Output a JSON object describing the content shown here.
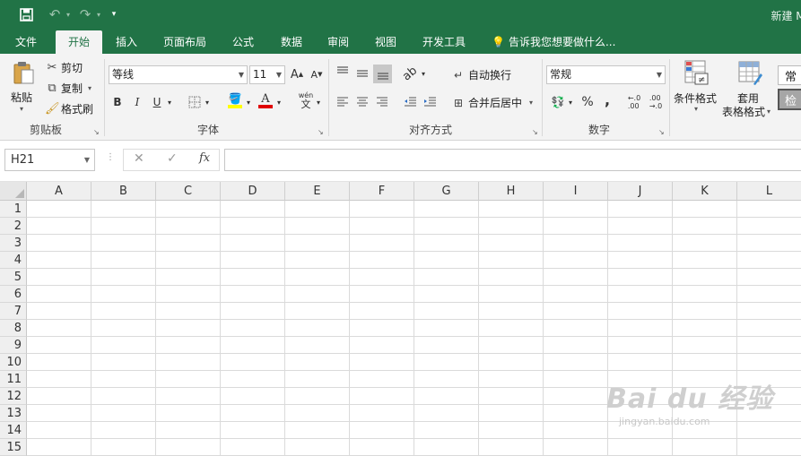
{
  "colors": {
    "brand": "#217346",
    "ribbon_bg": "#f3f3f3",
    "font_color_bar": "#e00000",
    "fill_color_bar": "#ffff00"
  },
  "titlebar": {
    "save_icon": "save-icon",
    "undo_icon": "undo-icon",
    "redo_icon": "redo-icon",
    "title": "新建 Mi"
  },
  "tabs": [
    {
      "label": "文件"
    },
    {
      "label": "开始"
    },
    {
      "label": "插入"
    },
    {
      "label": "页面布局"
    },
    {
      "label": "公式"
    },
    {
      "label": "数据"
    },
    {
      "label": "审阅"
    },
    {
      "label": "视图"
    },
    {
      "label": "开发工具"
    }
  ],
  "tell_me": "告诉我您想要做什么...",
  "clipboard": {
    "paste": "粘贴",
    "cut": "剪切",
    "copy": "复制",
    "format_painter": "格式刷",
    "group": "剪贴板"
  },
  "font": {
    "name": "等线",
    "size": "11",
    "bold": "B",
    "italic": "I",
    "underline": "U",
    "phonetic_top": "wén",
    "phonetic_bottom": "文",
    "grow": "A",
    "shrink": "A",
    "color_letter": "A",
    "group": "字体"
  },
  "alignment": {
    "wrap_text": "自动换行",
    "merge_center": "合并后居中",
    "group": "对齐方式"
  },
  "number": {
    "format": "常规",
    "percent": "%",
    "comma": ",",
    "group": "数字"
  },
  "styles": {
    "conditional": "条件格式",
    "table_top": "套用",
    "table_bottom": "表格格式",
    "style_normal": "常",
    "style_check": "检"
  },
  "formula_bar": {
    "name_box": "H21",
    "cancel": "✕",
    "enter": "✓",
    "fx": "fx"
  },
  "columns": [
    "A",
    "B",
    "C",
    "D",
    "E",
    "F",
    "G",
    "H",
    "I",
    "J",
    "K",
    "L"
  ],
  "rows": [
    "1",
    "2",
    "3",
    "4",
    "5",
    "6",
    "7",
    "8",
    "9",
    "10",
    "11",
    "12",
    "13",
    "14",
    "15"
  ],
  "watermark": {
    "main": "Bai du 经验",
    "sub": "jingyan.baidu.com"
  }
}
